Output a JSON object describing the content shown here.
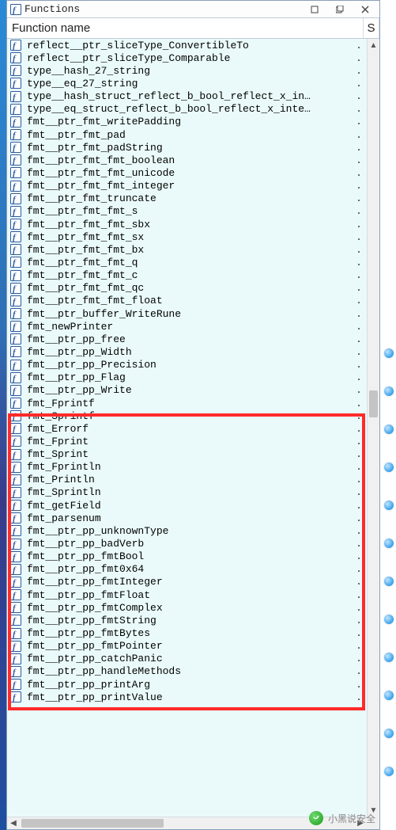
{
  "window": {
    "title": "Functions",
    "icon": "function-icon"
  },
  "columns": {
    "name_header": "Function name",
    "second_header": "S"
  },
  "highlight": {
    "start_index": 30,
    "end_index": 51
  },
  "functions": [
    {
      "name": "reflect__ptr_sliceType_ConvertibleTo",
      "seg": "."
    },
    {
      "name": "reflect__ptr_sliceType_Comparable",
      "seg": "."
    },
    {
      "name": "type__hash_27_string",
      "seg": "."
    },
    {
      "name": "type__eq_27_string",
      "seg": "."
    },
    {
      "name": "type__hash_struct_reflect_b_bool_reflect_x_in…",
      "seg": "."
    },
    {
      "name": "type__eq_struct_reflect_b_bool_reflect_x_inte…",
      "seg": "."
    },
    {
      "name": "fmt__ptr_fmt_writePadding",
      "seg": "."
    },
    {
      "name": "fmt__ptr_fmt_pad",
      "seg": "."
    },
    {
      "name": "fmt__ptr_fmt_padString",
      "seg": "."
    },
    {
      "name": "fmt__ptr_fmt_fmt_boolean",
      "seg": "."
    },
    {
      "name": "fmt__ptr_fmt_fmt_unicode",
      "seg": "."
    },
    {
      "name": "fmt__ptr_fmt_fmt_integer",
      "seg": "."
    },
    {
      "name": "fmt__ptr_fmt_truncate",
      "seg": "."
    },
    {
      "name": "fmt__ptr_fmt_fmt_s",
      "seg": "."
    },
    {
      "name": "fmt__ptr_fmt_fmt_sbx",
      "seg": "."
    },
    {
      "name": "fmt__ptr_fmt_fmt_sx",
      "seg": "."
    },
    {
      "name": "fmt__ptr_fmt_fmt_bx",
      "seg": "."
    },
    {
      "name": "fmt__ptr_fmt_fmt_q",
      "seg": "."
    },
    {
      "name": "fmt__ptr_fmt_fmt_c",
      "seg": "."
    },
    {
      "name": "fmt__ptr_fmt_fmt_qc",
      "seg": "."
    },
    {
      "name": "fmt__ptr_fmt_fmt_float",
      "seg": "."
    },
    {
      "name": "fmt__ptr_buffer_WriteRune",
      "seg": "."
    },
    {
      "name": "fmt_newPrinter",
      "seg": "."
    },
    {
      "name": "fmt__ptr_pp_free",
      "seg": "."
    },
    {
      "name": "fmt__ptr_pp_Width",
      "seg": "."
    },
    {
      "name": "fmt__ptr_pp_Precision",
      "seg": "."
    },
    {
      "name": "fmt__ptr_pp_Flag",
      "seg": "."
    },
    {
      "name": "fmt__ptr_pp_Write",
      "seg": "."
    },
    {
      "name": "fmt_Fprintf",
      "seg": "."
    },
    {
      "name": "fmt_Sprintf",
      "seg": "."
    },
    {
      "name": "fmt_Errorf",
      "seg": "."
    },
    {
      "name": "fmt_Fprint",
      "seg": "."
    },
    {
      "name": "fmt_Sprint",
      "seg": "."
    },
    {
      "name": "fmt_Fprintln",
      "seg": "."
    },
    {
      "name": "fmt_Println",
      "seg": "."
    },
    {
      "name": "fmt_Sprintln",
      "seg": "."
    },
    {
      "name": "fmt_getField",
      "seg": "."
    },
    {
      "name": "fmt_parsenum",
      "seg": "."
    },
    {
      "name": "fmt__ptr_pp_unknownType",
      "seg": "."
    },
    {
      "name": "fmt__ptr_pp_badVerb",
      "seg": "."
    },
    {
      "name": "fmt__ptr_pp_fmtBool",
      "seg": "."
    },
    {
      "name": "fmt__ptr_pp_fmt0x64",
      "seg": "."
    },
    {
      "name": "fmt__ptr_pp_fmtInteger",
      "seg": "."
    },
    {
      "name": "fmt__ptr_pp_fmtFloat",
      "seg": "."
    },
    {
      "name": "fmt__ptr_pp_fmtComplex",
      "seg": "."
    },
    {
      "name": "fmt__ptr_pp_fmtString",
      "seg": "."
    },
    {
      "name": "fmt__ptr_pp_fmtBytes",
      "seg": "."
    },
    {
      "name": "fmt__ptr_pp_fmtPointer",
      "seg": "."
    },
    {
      "name": "fmt__ptr_pp_catchPanic",
      "seg": "."
    },
    {
      "name": "fmt__ptr_pp_handleMethods",
      "seg": "."
    },
    {
      "name": "fmt__ptr_pp_printArg",
      "seg": "."
    },
    {
      "name": "fmt__ptr_pp_printValue",
      "seg": "."
    }
  ],
  "side_dots_count": 12,
  "watermark_text": "小黑说安全"
}
